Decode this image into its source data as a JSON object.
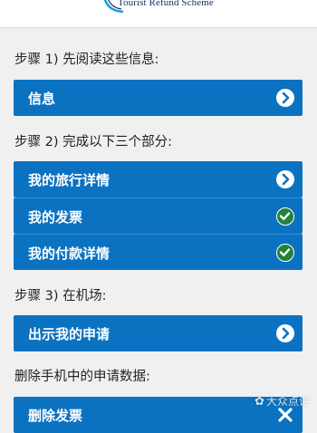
{
  "header": {
    "logo_text": "Tourist Refund Scheme"
  },
  "steps": [
    {
      "label": "步骤 1) 先阅读这些信息:"
    },
    {
      "label": "步骤 2) 完成以下三个部分:"
    },
    {
      "label": "步骤 3) 在机场:"
    },
    {
      "label": "删除手机中的申请数据:"
    }
  ],
  "buttons": {
    "info": {
      "label": "信息",
      "icon": "chevron-right-icon"
    },
    "travel_details": {
      "label": "我的旅行详情",
      "icon": "chevron-right-icon"
    },
    "invoice": {
      "label": "我的发票",
      "icon": "check-icon"
    },
    "payment_details": {
      "label": "我的付款详情",
      "icon": "check-icon"
    },
    "show_application": {
      "label": "出示我的申请",
      "icon": "chevron-right-icon"
    },
    "delete_invoice": {
      "label": "删除发票",
      "icon": "close-icon"
    }
  },
  "watermark": {
    "text": "大众点评"
  },
  "colors": {
    "background": "#f0f0f0",
    "button": "#0b72c2",
    "check": "#23823a",
    "logo": "#1a2d66"
  }
}
